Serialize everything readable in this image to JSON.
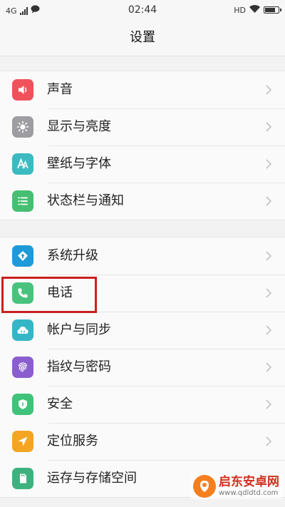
{
  "status_bar": {
    "network": "4G",
    "time": "02:44",
    "hd": "HD",
    "battery_level": 0.85
  },
  "header": {
    "title": "设置"
  },
  "groups": [
    {
      "items": [
        {
          "label": "声音",
          "icon": "speaker-icon",
          "color": "#f0525c"
        },
        {
          "label": "显示与亮度",
          "icon": "brightness-icon",
          "color": "#9e9ea2"
        },
        {
          "label": "壁纸与字体",
          "icon": "font-icon",
          "color": "#3bbbc1"
        },
        {
          "label": "状态栏与通知",
          "icon": "notification-list-icon",
          "color": "#47bf72"
        }
      ]
    },
    {
      "items": [
        {
          "label": "系统升级",
          "icon": "upgrade-icon",
          "color": "#1e9ad8"
        },
        {
          "label": "电话",
          "icon": "phone-icon",
          "color": "#49c27e"
        },
        {
          "label": "帐户与同步",
          "icon": "cloud-sync-icon",
          "color": "#35b6c6"
        },
        {
          "label": "指纹与密码",
          "icon": "fingerprint-icon",
          "color": "#8b5ecf"
        },
        {
          "label": "安全",
          "icon": "shield-icon",
          "color": "#3fc37a"
        },
        {
          "label": "定位服务",
          "icon": "location-icon",
          "color": "#f4a623"
        },
        {
          "label": "运存与存储空间",
          "icon": "storage-icon",
          "color": "#3db27e"
        }
      ]
    }
  ],
  "watermark": {
    "title": "启东安卓网",
    "url": "www.qdldtd.com",
    "color": "#f57f1f"
  }
}
